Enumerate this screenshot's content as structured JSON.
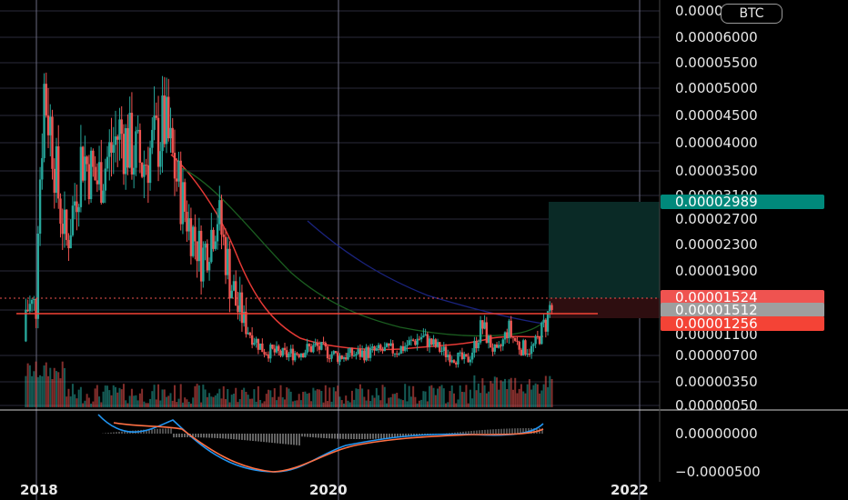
{
  "currency_badge": "BTC",
  "colors": {
    "background": "#000000",
    "grid": "#2a2a3a",
    "up_candle": "#26a69a",
    "down_candle": "#ef5350",
    "ema_fast": "#e53935",
    "ema_mid": "#1b5e20",
    "ema_slow": "#1a237e",
    "macd_line": "#2196f3",
    "signal_line": "#ff7043",
    "target_zone": "#0a2a26",
    "stop_zone": "#2e0e10",
    "tag_target": "#00897b",
    "tag_price": "#ef5350",
    "tag_entry": "#9e9e9e",
    "tag_stop": "#f44336"
  },
  "chart_data": {
    "type": "candlestick",
    "quote_unit": "BTC",
    "price_axis": {
      "tick_labels": [
        "0.00000050",
        "0.00000350",
        "0.00000700",
        "0.00001100",
        "0.00001512",
        "0.00001900",
        "0.00002300",
        "0.00002700",
        "0.00003100",
        "0.00003500",
        "0.00004000",
        "0.00004500",
        "0.00005000",
        "0.00005500",
        "0.00006000",
        "0.0000"
      ],
      "scale": "log"
    },
    "time_axis": {
      "tick_labels": [
        "2018",
        "2020",
        "2022"
      ],
      "range": [
        2017.95,
        2022.1
      ]
    },
    "price_tags": [
      {
        "name": "target",
        "value": "0.00002989"
      },
      {
        "name": "last",
        "value": "0.00001524"
      },
      {
        "name": "entry",
        "value": "0.00001512"
      },
      {
        "name": "stop",
        "value": "0.00001256"
      }
    ],
    "candles_approx": [
      {
        "t": 2018.0,
        "o": 9.5e-06,
        "c": 2.4e-05,
        "h": 5.6e-05,
        "l": 6.8e-06
      },
      {
        "t": 2018.05,
        "o": 2.4e-05,
        "c": 5e-05,
        "h": 5.8e-05,
        "l": 2e-05
      },
      {
        "t": 2018.1,
        "o": 5e-05,
        "c": 4.2e-05,
        "h": 5.3e-05,
        "l": 3.3e-05
      },
      {
        "t": 2018.15,
        "o": 4.2e-05,
        "c": 3e-05,
        "h": 4.5e-05,
        "l": 2.4e-05
      },
      {
        "t": 2018.2,
        "o": 3e-05,
        "c": 2.3e-05,
        "h": 3.2e-05,
        "l": 2e-05
      },
      {
        "t": 2018.3,
        "o": 2.3e-05,
        "c": 3.8e-05,
        "h": 4.2e-05,
        "l": 2.2e-05
      },
      {
        "t": 2018.4,
        "o": 3.8e-05,
        "c": 3.3e-05,
        "h": 5e-05,
        "l": 3e-05
      },
      {
        "t": 2018.55,
        "o": 3.3e-05,
        "c": 4.2e-05,
        "h": 4.4e-05,
        "l": 2.9e-05
      },
      {
        "t": 2018.7,
        "o": 4.2e-05,
        "c": 3.6e-05,
        "h": 4.5e-05,
        "l": 3e-05
      },
      {
        "t": 2018.85,
        "o": 3.6e-05,
        "c": 4.3e-05,
        "h": 4.7e-05,
        "l": 3.4e-05
      },
      {
        "t": 2019.0,
        "o": 3.5e-05,
        "c": 2.7e-05,
        "h": 3.7e-05,
        "l": 2.5e-05
      },
      {
        "t": 2019.1,
        "o": 2.7e-05,
        "c": 2.1e-05,
        "h": 2.9e-05,
        "l": 1.9e-05
      },
      {
        "t": 2019.2,
        "o": 2.1e-05,
        "c": 2.8e-05,
        "h": 3e-05,
        "l": 2e-05
      },
      {
        "t": 2019.3,
        "o": 2.8e-05,
        "c": 1.7e-05,
        "h": 2.9e-05,
        "l": 1.3e-05
      },
      {
        "t": 2019.4,
        "o": 1.7e-05,
        "c": 1.2e-05,
        "h": 1.8e-05,
        "l": 1e-05
      },
      {
        "t": 2019.5,
        "o": 1.2e-05,
        "c": 8e-06,
        "h": 1.25e-05,
        "l": 6.8e-06
      },
      {
        "t": 2019.65,
        "o": 8e-06,
        "c": 7e-06,
        "h": 9e-06,
        "l": 6e-06
      },
      {
        "t": 2019.85,
        "o": 7e-06,
        "c": 8.5e-06,
        "h": 9.5e-06,
        "l": 6.5e-06
      },
      {
        "t": 2020.0,
        "o": 8.5e-06,
        "c": 6.8e-06,
        "h": 9e-06,
        "l": 6e-06
      },
      {
        "t": 2020.2,
        "o": 6.8e-06,
        "c": 7.5e-06,
        "h": 8.2e-06,
        "l": 6.2e-06
      },
      {
        "t": 2020.4,
        "o": 7.5e-06,
        "c": 8e-06,
        "h": 8.8e-06,
        "l": 6.8e-06
      },
      {
        "t": 2020.55,
        "o": 8e-06,
        "c": 1.05e-05,
        "h": 1.2e-05,
        "l": 7.5e-06
      },
      {
        "t": 2020.7,
        "o": 9e-06,
        "c": 7.5e-06,
        "h": 9.5e-06,
        "l": 6.8e-06
      },
      {
        "t": 2020.85,
        "o": 7.5e-06,
        "c": 6e-06,
        "h": 7.8e-06,
        "l": 4.8e-06
      },
      {
        "t": 2020.95,
        "o": 6e-06,
        "c": 1.25e-05,
        "h": 1.4e-05,
        "l": 5.8e-06
      },
      {
        "t": 2021.05,
        "o": 1e-05,
        "c": 7e-06,
        "h": 1.1e-05,
        "l": 4.8e-06
      },
      {
        "t": 2021.12,
        "o": 7e-06,
        "c": 1.2e-05,
        "h": 1.3e-05,
        "l": 6.6e-06
      },
      {
        "t": 2021.2,
        "o": 1.2e-05,
        "c": 8.5e-06,
        "h": 1.35e-05,
        "l": 7.5e-06
      },
      {
        "t": 2021.28,
        "o": 8.5e-06,
        "c": 8e-06,
        "h": 1e-05,
        "l": 7e-06
      },
      {
        "t": 2021.34,
        "o": 8e-06,
        "c": 1.1e-05,
        "h": 1.15e-05,
        "l": 7.5e-06
      },
      {
        "t": 2021.4,
        "o": 1.1e-05,
        "c": 1.52e-05,
        "h": 1.6e-05,
        "l": 1.08e-05
      }
    ],
    "indicators": {
      "macd_axis": {
        "tick_labels": [
          "0.00000000",
          "−0.0000500"
        ]
      }
    }
  }
}
